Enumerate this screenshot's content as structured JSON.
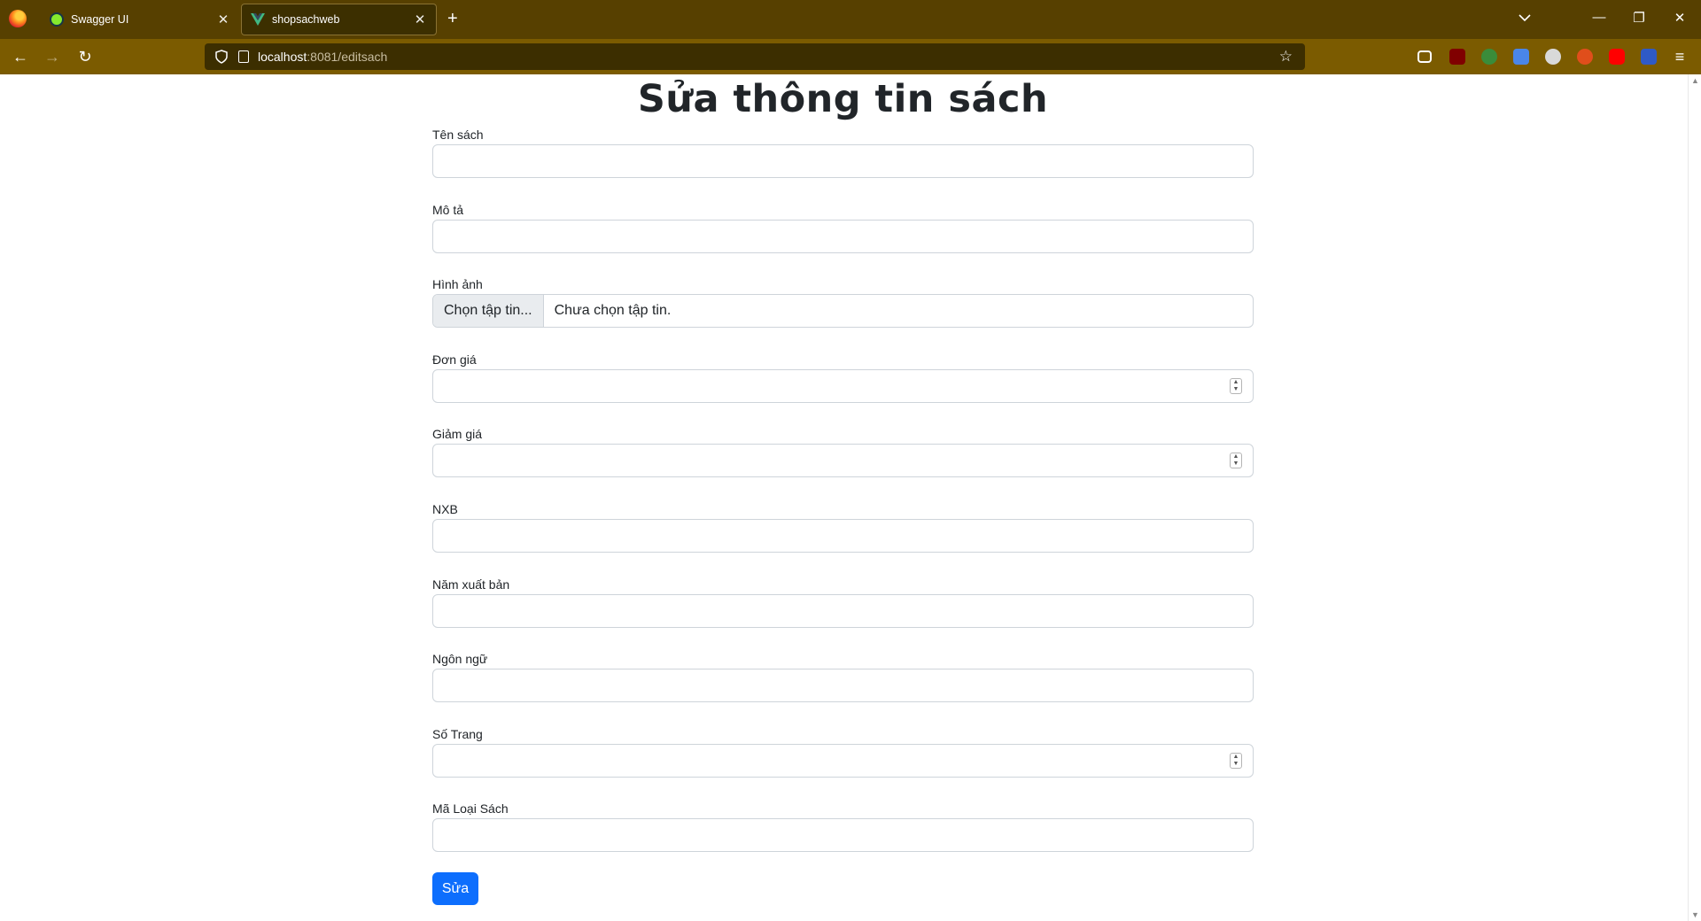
{
  "browser": {
    "tabs": [
      {
        "title": "Swagger UI",
        "active": false
      },
      {
        "title": "shopsachweb",
        "active": true
      }
    ],
    "url_host": "localhost",
    "url_rest": ":8081/editsach",
    "accent": "#574000"
  },
  "page": {
    "title": "Sửa thông tin sách",
    "fields": [
      {
        "label": "Tên sách",
        "type": "text",
        "value": ""
      },
      {
        "label": "Mô tả",
        "type": "text",
        "value": ""
      },
      {
        "label": "Hình ảnh",
        "type": "file",
        "button": "Chọn tập tin...",
        "status": "Chưa chọn tập tin."
      },
      {
        "label": "Đơn giá",
        "type": "number",
        "value": ""
      },
      {
        "label": "Giảm giá",
        "type": "number",
        "value": ""
      },
      {
        "label": "NXB",
        "type": "text",
        "value": ""
      },
      {
        "label": "Năm xuất bản",
        "type": "text",
        "value": ""
      },
      {
        "label": "Ngôn ngữ",
        "type": "text",
        "value": ""
      },
      {
        "label": "Số Trang",
        "type": "number",
        "value": ""
      },
      {
        "label": "Mã Loại Sách",
        "type": "text",
        "value": ""
      }
    ],
    "submit_label": "Sửa",
    "submit_color": "#0d6efd"
  }
}
